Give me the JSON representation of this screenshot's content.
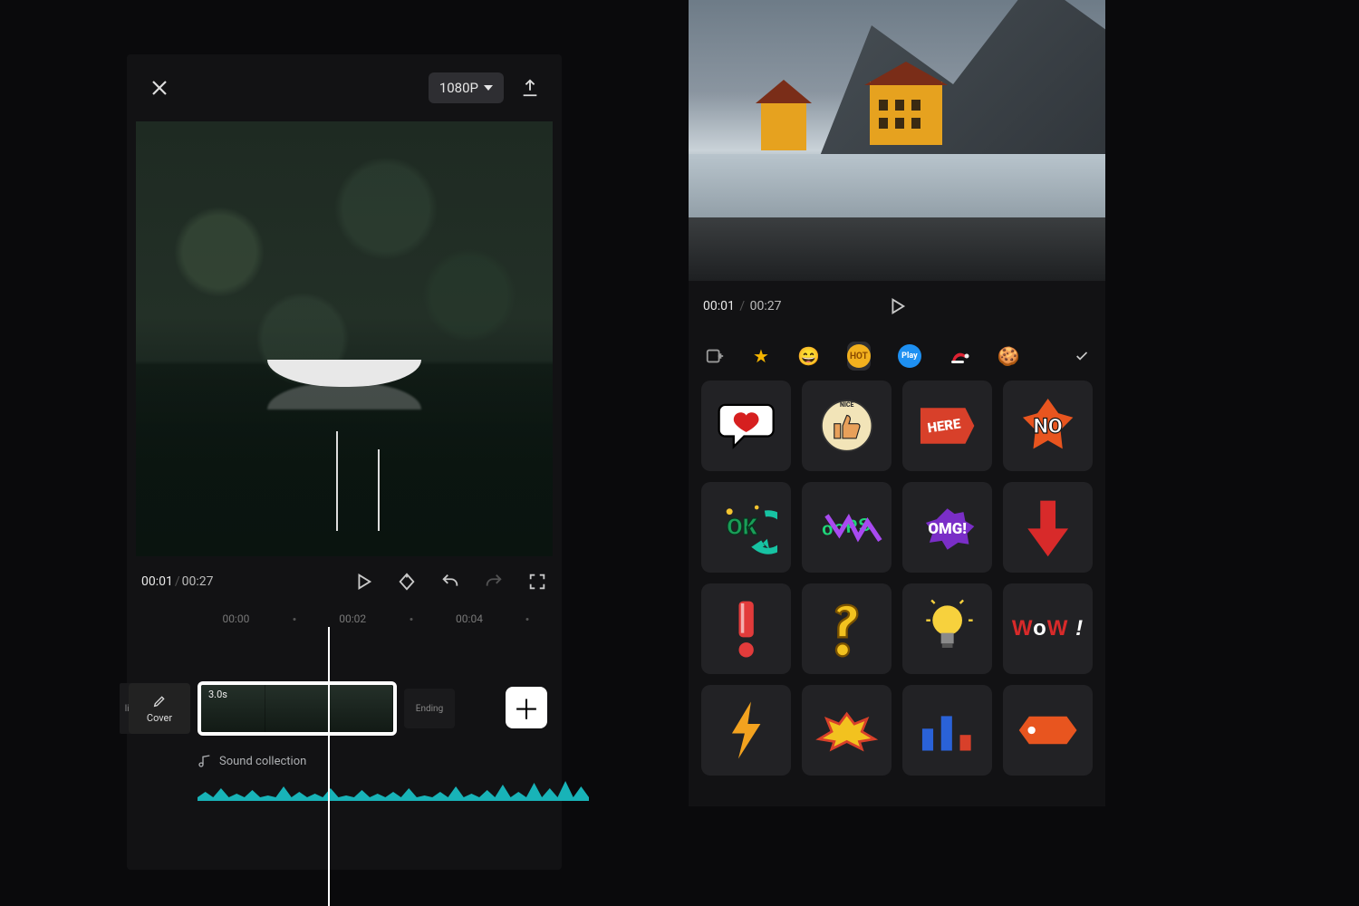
{
  "left": {
    "resolution": "1080P",
    "time_current": "00:01",
    "time_total": "00:27",
    "ruler": {
      "t0": "00:00",
      "t1": "00:02",
      "t2": "00:04"
    },
    "cover_label": "Cover",
    "lip_label": "lip",
    "clip_duration": "3.0s",
    "ending_label": "Ending",
    "sound_label": "Sound collection"
  },
  "right": {
    "time_current": "00:01",
    "time_total": "00:27",
    "categories": {
      "image": "image-add-icon",
      "star": "star-icon",
      "emoji": "emoji-icon",
      "hot": "hot-icon",
      "play": "play-badge-icon",
      "santa": "santa-hat-icon",
      "cookie": "cookie-icon"
    },
    "stickers": [
      {
        "name": "heart-bubble",
        "text": ""
      },
      {
        "name": "nice-thumbs-up",
        "text": "NICE"
      },
      {
        "name": "here",
        "text": "HERE"
      },
      {
        "name": "no",
        "text": "NO"
      },
      {
        "name": "ok",
        "text": "OK"
      },
      {
        "name": "oops",
        "text": "ooPS"
      },
      {
        "name": "omg",
        "text": "OMG!"
      },
      {
        "name": "red-down-arrow",
        "text": ""
      },
      {
        "name": "exclaim-red",
        "text": "!"
      },
      {
        "name": "question-yellow",
        "text": "?"
      },
      {
        "name": "lightbulb",
        "text": ""
      },
      {
        "name": "wow",
        "text": "WoW!"
      },
      {
        "name": "lightning",
        "text": ""
      },
      {
        "name": "pow",
        "text": ""
      },
      {
        "name": "bars",
        "text": ""
      },
      {
        "name": "tag",
        "text": ""
      }
    ]
  }
}
